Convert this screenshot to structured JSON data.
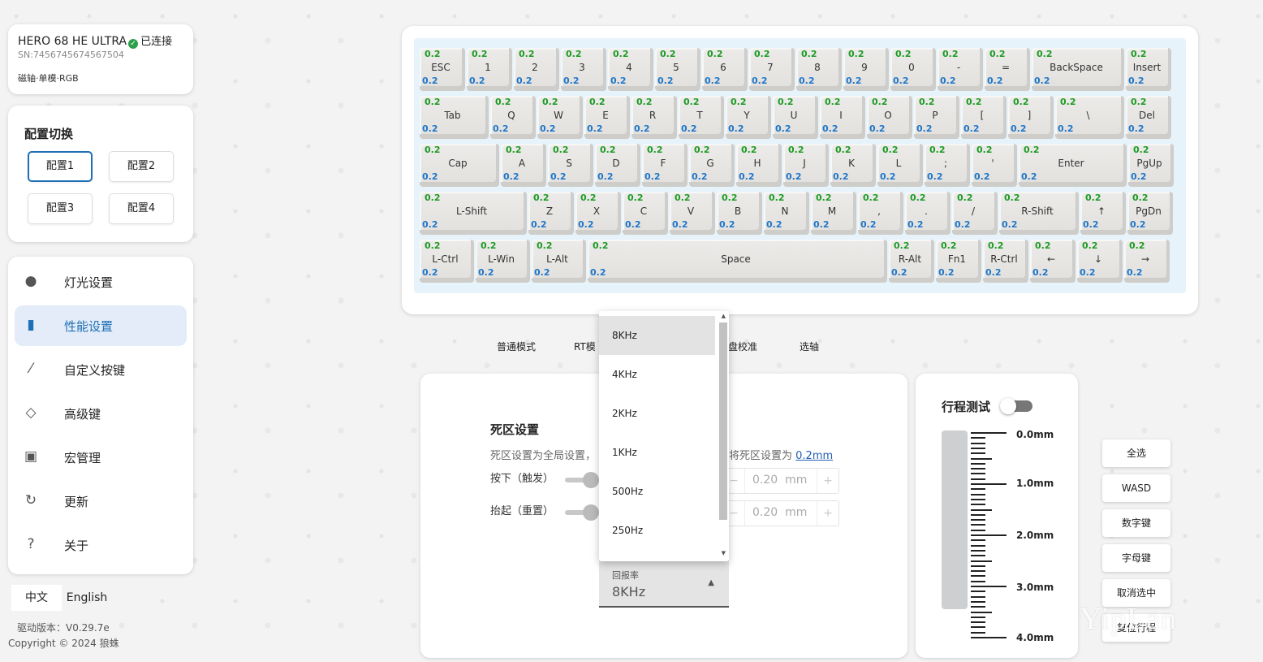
{
  "device": {
    "name": "HERO 68 HE ULTRA",
    "status": "已连接",
    "sn": "SN:7456745674567504",
    "type": "磁轴·单模·RGB"
  },
  "profile": {
    "title": "配置切换",
    "items": [
      "配置1",
      "配置2",
      "配置3",
      "配置4"
    ],
    "active": 0
  },
  "nav": {
    "items": [
      {
        "label": "灯光设置",
        "icon": "bulb-icon"
      },
      {
        "label": "性能设置",
        "icon": "chart-icon"
      },
      {
        "label": "自定义按键",
        "icon": "key-remap-icon"
      },
      {
        "label": "高级键",
        "icon": "advanced-key-icon"
      },
      {
        "label": "宏管理",
        "icon": "macro-icon"
      },
      {
        "label": "更新",
        "icon": "refresh-icon"
      },
      {
        "label": "关于",
        "icon": "question-icon"
      }
    ],
    "active": 1
  },
  "lang": {
    "zh": "中文",
    "en": "English"
  },
  "version": "驱动版本：V0.29.7e",
  "copyright": "Copyright © 2024 狼蛛",
  "keyboard": {
    "rows": [
      [
        "ESC",
        "1",
        "2",
        "3",
        "4",
        "5",
        "6",
        "7",
        "8",
        "9",
        "0",
        "-",
        "=",
        "BackSpace",
        "Insert"
      ],
      [
        "Tab",
        "Q",
        "W",
        "E",
        "R",
        "T",
        "Y",
        "U",
        "I",
        "O",
        "P",
        "[",
        "]",
        "\\",
        "Del"
      ],
      [
        "Cap",
        "A",
        "S",
        "D",
        "F",
        "G",
        "H",
        "J",
        "K",
        "L",
        ";",
        "'",
        "Enter",
        "PgUp"
      ],
      [
        "L-Shift",
        "Z",
        "X",
        "C",
        "V",
        "B",
        "N",
        "M",
        ",",
        ".",
        "/",
        "R-Shift",
        "↑",
        "PgDn"
      ],
      [
        "L-Ctrl",
        "L-Win",
        "L-Alt",
        "Space",
        "R-Alt",
        "Fn1",
        "R-Ctrl",
        "←",
        "↓",
        "→"
      ]
    ],
    "press_value": "0.2",
    "release_value": "0.2"
  },
  "modes": [
    "普通模式",
    "RT模",
    "盘校准",
    "选轴"
  ],
  "deadzone": {
    "title": "死区设置",
    "desc": "死区设置为全局设置，",
    "desc2_prefix": "将死区设置为",
    "desc2_link": "0.2mm",
    "press_label": "按下（触发）",
    "release_label": "抬起（重置）",
    "press_value": "0.20",
    "release_value": "0.20",
    "unit": "mm",
    "minus": "−",
    "plus": "+"
  },
  "polling": {
    "options": [
      "8KHz",
      "4KHz",
      "2KHz",
      "1KHz",
      "500Hz",
      "250Hz"
    ],
    "selected_index": 0,
    "label": "回报率",
    "value": "8KHz"
  },
  "travel": {
    "title": "行程测试",
    "ticks": [
      "0.0mm",
      "1.0mm",
      "2.0mm",
      "3.0mm",
      "4.0mm"
    ]
  },
  "side_buttons": [
    "全选",
    "WASD",
    "数字键",
    "字母键",
    "取消选中",
    "复位行程"
  ],
  "watermark": "YipLan",
  "colors": {
    "accent": "#1f6fb5",
    "top_value": "#1d9b25",
    "bottom_value": "#1f76c9"
  }
}
